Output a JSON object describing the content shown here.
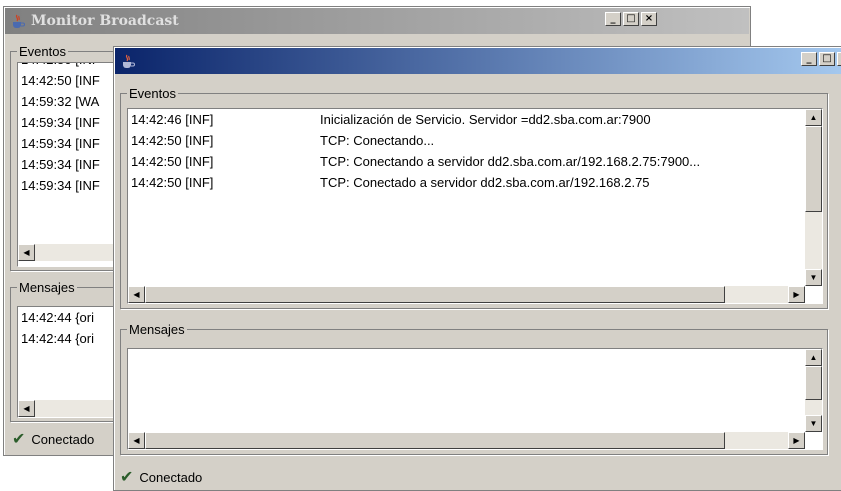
{
  "back_window": {
    "title": "Monitor Broadcast",
    "eventos_label": "Eventos",
    "events_partial": [
      "14:42:50 [INF",
      "14:42:50 [INF",
      "14:59:32 [WA",
      "14:59:34 [INF",
      "14:59:34 [INF",
      "14:59:34 [INF",
      "14:59:34 [INF"
    ],
    "mensajes_label": "Mensajes",
    "messages_partial": [
      "14:42:44 {ori",
      "14:42:44 {ori"
    ],
    "status": "Conectado"
  },
  "front_window": {
    "title": "",
    "eventos_label": "Eventos",
    "events": [
      {
        "time": "14:42:46 [INF]",
        "message": "Inicialización de Servicio. Servidor =dd2.sba.com.ar:7900"
      },
      {
        "time": "14:42:50 [INF]",
        "message": "TCP: Conectando..."
      },
      {
        "time": "14:42:50 [INF]",
        "message": "TCP: Conectando a servidor dd2.sba.com.ar/192.168.2.75:7900..."
      },
      {
        "time": "14:42:50 [INF]",
        "message": "TCP: Conectado a servidor dd2.sba.com.ar/192.168.2.75"
      }
    ],
    "mensajes_label": "Mensajes",
    "status": "Conectado"
  },
  "window_buttons": {
    "minimize": "_",
    "maximize": "□",
    "close": "×"
  },
  "icons": {
    "app": "java-cup-icon",
    "status": "checkmark-icon"
  }
}
